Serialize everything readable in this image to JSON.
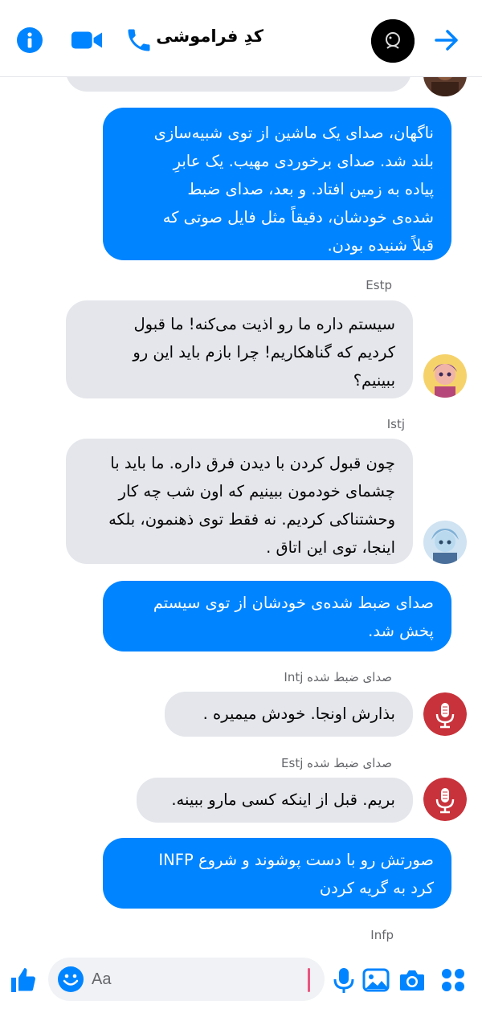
{
  "colors": {
    "accent": "#0084ff",
    "sent_bubble": "#0084ff",
    "received_bubble": "#e4e6eb",
    "meta_text": "#65676b",
    "voice_avatar": "#c8323a"
  },
  "header": {
    "title": "کدِ فراموشی",
    "icons": [
      "info-icon",
      "video-call-icon",
      "phone-icon",
      "group-avatar",
      "forward-arrow-icon"
    ]
  },
  "messages": [
    {
      "id": "m1",
      "type": "sent",
      "lines": [
        "ناگهان، صدای یک ماشین از توی شبیه‌سازی",
        "بلند شد. صدای برخوردی مهیب. یک عابرِ",
        "پیاده به زمین افتاد. و بعد، صدای ضبط",
        "شده‌ی خودشان، دقیقاً مثل فایل صوتی که",
        "قبلاً شنیده بودن."
      ]
    },
    {
      "id": "m2",
      "type": "received",
      "sender": "Estp",
      "lines": [
        "سیستم داره ما رو اذیت می‌کنه! ما قبول",
        "کردیم که گناهکاریم! چرا بازم باید این رو",
        "ببینیم؟"
      ]
    },
    {
      "id": "m3",
      "type": "received",
      "sender": "Istj",
      "lines": [
        "چون قبول کردن با دیدن فرق داره. ما باید با",
        "چشمای خودمون ببینیم که اون شب چه کار",
        "وحشتناکی کردیم. نه فقط توی ذهنمون، بلکه",
        "اینجا، توی این اتاق ."
      ]
    },
    {
      "id": "m4",
      "type": "sent",
      "lines": [
        "صدای ضبط شده‌ی خودشان از توی سیستم",
        "پخش شد."
      ]
    },
    {
      "id": "m5",
      "type": "received",
      "sender": "صدای ضبط شده Intj",
      "lines": [
        "بذارش اونجا. خودش میمیره ."
      ]
    },
    {
      "id": "m6",
      "type": "received",
      "sender": "صدای ضبط شده Estj",
      "lines": [
        "بریم. قبل از اینکه کسی مارو ببینه."
      ]
    },
    {
      "id": "m7",
      "type": "sent",
      "lines": [
        "صورتش رو با دست پوشوند و شروع INFP",
        "کرد به  گریه کردن"
      ]
    }
  ],
  "typing_sender": "Infp",
  "composer": {
    "placeholder": "Aa",
    "value": "",
    "icons": [
      "like-icon",
      "emoji-icon",
      "microphone-icon",
      "gallery-icon",
      "camera-icon",
      "apps-icon"
    ]
  }
}
